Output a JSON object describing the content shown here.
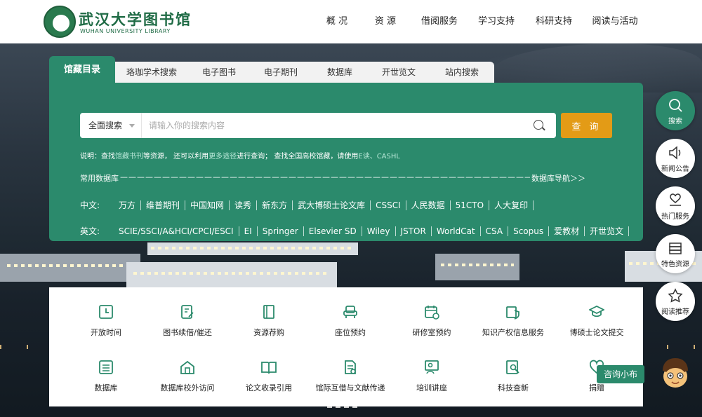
{
  "header": {
    "logo_cn": "武汉大学图书馆",
    "logo_en": "WUHAN UNIVERSITY LIBRARY",
    "nav": [
      "概 况",
      "资 源",
      "借阅服务",
      "学习支持",
      "科研支持",
      "阅读与活动"
    ]
  },
  "search": {
    "tabs": [
      "馆藏目录",
      "珞珈学术搜索",
      "电子图书",
      "电子期刊",
      "数据库",
      "开世览文",
      "站内搜索"
    ],
    "scope": "全面搜索",
    "placeholder": "请输入你的搜索内容",
    "button": "查 询",
    "hint": {
      "p1": "说明：查找",
      "l1": "馆藏书刊",
      "p2": "等资源， 还可以利用",
      "l2": "更多途径",
      "p3": "进行查询； 查找全国高校馆藏，请使用",
      "l3": "E读、CASHL"
    },
    "common_db_label": "常用数据库",
    "dashes": "——————————————————————————————————————————————————————————————",
    "db_nav": "数据库导航＞＞",
    "cn_label": "中文:",
    "cn_items": [
      "万方",
      "维普期刊",
      "中国知网",
      "读秀",
      "新东方",
      "武大博硕士论文库",
      "CSSCI",
      "人民数据",
      "51CTO",
      "人大复印"
    ],
    "en_label": "英文:",
    "en_items": [
      "SCIE/SSCI/A&HCI/CPCI/ESCI",
      "EI",
      "Springer",
      "Elsevier SD",
      "Wiley",
      "JSTOR",
      "WorldCat",
      "CSA",
      "Scopus",
      "爱教材",
      "开世览文"
    ]
  },
  "sidebar": [
    {
      "label": "搜索",
      "icon": "search-icon"
    },
    {
      "label": "新闻公告",
      "icon": "speaker-icon"
    },
    {
      "label": "热门服务",
      "icon": "heart-hand-icon"
    },
    {
      "label": "特色资源",
      "icon": "books-icon"
    },
    {
      "label": "阅读推荐",
      "icon": "star-icon"
    }
  ],
  "services": [
    {
      "label": "开放时间",
      "icon": "clock-icon"
    },
    {
      "label": "图书续借/催还",
      "icon": "renew-icon"
    },
    {
      "label": "资源荐购",
      "icon": "book-icon"
    },
    {
      "label": "座位预约",
      "icon": "seat-icon"
    },
    {
      "label": "研修室预约",
      "icon": "calendar-icon"
    },
    {
      "label": "知识产权信息服务",
      "icon": "ip-icon"
    },
    {
      "label": "博硕士论文提交",
      "icon": "graduation-cap-icon"
    },
    {
      "label": "数据库",
      "icon": "database-icon"
    },
    {
      "label": "数据库校外访问",
      "icon": "home-network-icon"
    },
    {
      "label": "论文收录引用",
      "icon": "open-book-icon"
    },
    {
      "label": "馆际互借与文献传递",
      "icon": "document-transfer-icon"
    },
    {
      "label": "培训讲座",
      "icon": "lecture-icon"
    },
    {
      "label": "科技查新",
      "icon": "search-document-icon"
    },
    {
      "label": "捐赠",
      "icon": "heart-icon"
    }
  ],
  "consult_label": "咨询小布",
  "colors": {
    "brand": "#2b8a6c",
    "accent": "#e39b16",
    "logo": "#1f6b45"
  }
}
